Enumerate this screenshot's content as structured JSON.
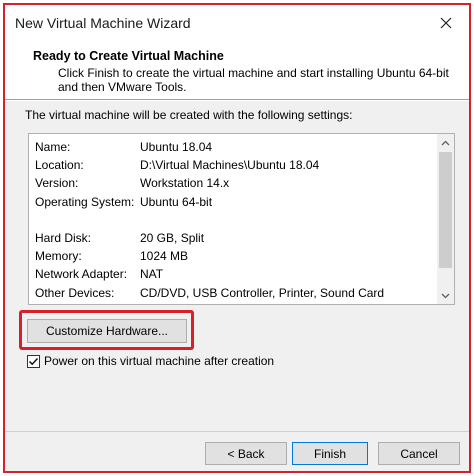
{
  "window": {
    "title": "New Virtual Machine Wizard"
  },
  "header": {
    "title": "Ready to Create Virtual Machine",
    "description": "Click Finish to create the virtual machine and start installing Ubuntu 64-bit and then VMware Tools."
  },
  "intro": "The virtual machine will be created with the following settings:",
  "settings": [
    {
      "key": "Name:",
      "value": "Ubuntu 18.04"
    },
    {
      "key": "Location:",
      "value": "D:\\Virtual Machines\\Ubuntu 18.04"
    },
    {
      "key": "Version:",
      "value": "Workstation 14.x"
    },
    {
      "key": "Operating System:",
      "value": "Ubuntu 64-bit"
    },
    {
      "key": "",
      "value": ""
    },
    {
      "key": "Hard Disk:",
      "value": "20 GB, Split"
    },
    {
      "key": "Memory:",
      "value": "1024 MB"
    },
    {
      "key": "Network Adapter:",
      "value": "NAT"
    },
    {
      "key": "Other Devices:",
      "value": "CD/DVD, USB Controller, Printer, Sound Card"
    }
  ],
  "buttons": {
    "customize": "Customize Hardware...",
    "back": "< Back",
    "finish": "Finish",
    "cancel": "Cancel"
  },
  "checkbox": {
    "label": "Power on this virtual machine after creation",
    "checked": true
  },
  "colors": {
    "highlight": "#d8202b",
    "dialog_bg": "#f0f0f0",
    "default_button_border": "#0078d7"
  },
  "icons": {
    "close": "close-icon",
    "scroll_up": "chevron-up-icon",
    "scroll_down": "chevron-down-icon",
    "check": "checkmark-icon"
  }
}
